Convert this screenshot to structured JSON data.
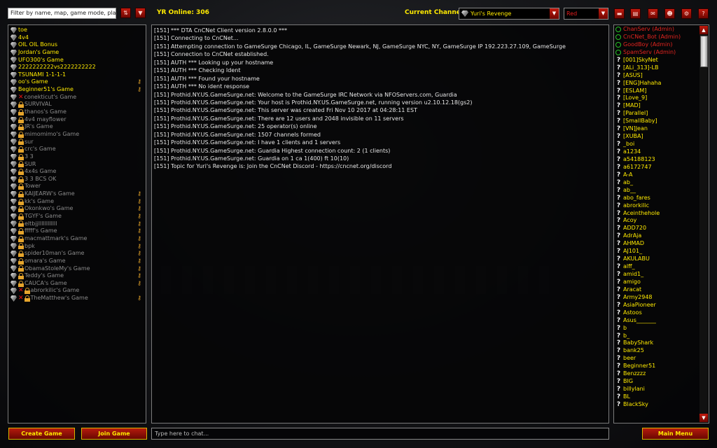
{
  "header": {
    "search_placeholder": "Filter by name, map, game mode, player...",
    "yr_online": "YR Online: 306",
    "current_channel_label": "Current Channel:",
    "channel": "Yuri's Revenge",
    "color": "Red"
  },
  "games": [
    {
      "name": "toe",
      "open": true,
      "locked": false,
      "x": false,
      "key": false
    },
    {
      "name": "4v4",
      "open": true,
      "locked": false,
      "x": false,
      "key": false
    },
    {
      "name": "OIL OIL Bonus",
      "open": true,
      "locked": false,
      "x": false,
      "key": false
    },
    {
      "name": "Jordan's Game",
      "open": true,
      "locked": false,
      "x": false,
      "key": false
    },
    {
      "name": "UFO300's Game",
      "open": true,
      "locked": false,
      "x": false,
      "key": false
    },
    {
      "name": "2222222222vs2222222222",
      "open": true,
      "locked": false,
      "x": false,
      "key": false
    },
    {
      "name": "TSUNAMI 1-1-1-1",
      "open": true,
      "locked": false,
      "x": false,
      "key": false
    },
    {
      "name": "oo's Game",
      "open": true,
      "locked": false,
      "x": false,
      "key": true
    },
    {
      "name": "Beginner51's Game",
      "open": true,
      "locked": false,
      "x": false,
      "key": true
    },
    {
      "name": "conekticut's Game",
      "open": false,
      "locked": false,
      "x": true,
      "key": false
    },
    {
      "name": "SURVIVAL",
      "open": false,
      "locked": true,
      "x": false,
      "key": false
    },
    {
      "name": "thanos's Game",
      "open": false,
      "locked": true,
      "x": false,
      "key": false
    },
    {
      "name": "4v4 mayflower",
      "open": false,
      "locked": true,
      "x": false,
      "key": false
    },
    {
      "name": "JR's Game",
      "open": false,
      "locked": true,
      "x": false,
      "key": false
    },
    {
      "name": "mimomimo's Game",
      "open": false,
      "locked": true,
      "x": false,
      "key": false
    },
    {
      "name": "sur",
      "open": false,
      "locked": true,
      "x": false,
      "key": false
    },
    {
      "name": "crc's Game",
      "open": false,
      "locked": true,
      "x": false,
      "key": false
    },
    {
      "name": "3 3",
      "open": false,
      "locked": true,
      "x": false,
      "key": false
    },
    {
      "name": "SUR",
      "open": false,
      "locked": true,
      "x": false,
      "key": false
    },
    {
      "name": "4x4s Game",
      "open": false,
      "locked": true,
      "x": false,
      "key": false
    },
    {
      "name": "3 3 BCS OK",
      "open": false,
      "locked": true,
      "x": false,
      "key": false
    },
    {
      "name": "Tower",
      "open": false,
      "locked": true,
      "x": false,
      "key": false
    },
    {
      "name": "KAIJEARW's Game",
      "open": false,
      "locked": true,
      "x": false,
      "key": true
    },
    {
      "name": "kk's Game",
      "open": false,
      "locked": true,
      "x": false,
      "key": true
    },
    {
      "name": "Okonkwo's Game",
      "open": false,
      "locked": true,
      "x": false,
      "key": true
    },
    {
      "name": "TGYF's Game",
      "open": false,
      "locked": true,
      "x": false,
      "key": true
    },
    {
      "name": "eltbjjllllllllllll",
      "open": false,
      "locked": true,
      "x": false,
      "key": true
    },
    {
      "name": "fffff's Game",
      "open": false,
      "locked": true,
      "x": false,
      "key": true
    },
    {
      "name": "macmattmark's Game",
      "open": false,
      "locked": true,
      "x": false,
      "key": true
    },
    {
      "name": "bpk",
      "open": false,
      "locked": true,
      "x": false,
      "key": true
    },
    {
      "name": "spider10man's Game",
      "open": false,
      "locked": true,
      "x": false,
      "key": true
    },
    {
      "name": "omara's Game",
      "open": false,
      "locked": true,
      "x": false,
      "key": true
    },
    {
      "name": "ObamaStoleMy's Game",
      "open": false,
      "locked": true,
      "x": false,
      "key": true
    },
    {
      "name": "Teddy's Game",
      "open": false,
      "locked": true,
      "x": false,
      "key": true
    },
    {
      "name": "CAUCA's Game",
      "open": false,
      "locked": true,
      "x": false,
      "key": true
    },
    {
      "name": "abrorkilic's Game",
      "open": false,
      "locked": true,
      "x": true,
      "key": false
    },
    {
      "name": "TheMatthew's Game",
      "open": false,
      "locked": true,
      "x": true,
      "key": true
    }
  ],
  "chat_lines": [
    "[151] *** DTA CnCNet Client version 2.8.0.0 ***",
    "[151] Connecting to CnCNet...",
    "[151] Attempting connection to GameSurge Chicago, IL, GameSurge Newark, NJ, GameSurge NYC, NY, GameSurge IP 192.223.27.109, GameSurge",
    "[151] Connection to CnCNet established.",
    "[151] AUTH *** Looking up your hostname",
    "[151] AUTH *** Checking Ident",
    "[151] AUTH *** Found your hostname",
    "[151] AUTH *** No ident response",
    "[151] Prothid.NY.US.GameSurge.net: Welcome to the GameSurge IRC Network via NFOServers.com, Guardia",
    "[151] Prothid.NY.US.GameSurge.net: Your host is Prothid.NY.US.GameSurge.net, running version u2.10.12.18(gs2)",
    "[151] Prothid.NY.US.GameSurge.net: This server was created Fri Nov 10 2017 at 04:28:11 EST",
    "[151] Prothid.NY.US.GameSurge.net: There are 12 users and 2048 invisible on 11 servers",
    "[151] Prothid.NY.US.GameSurge.net: 25 operator(s) online",
    "[151] Prothid.NY.US.GameSurge.net: 1507 channels formed",
    "[151] Prothid.NY.US.GameSurge.net: I have 1 clients and 1 servers",
    "[151] Prothid.NY.US.GameSurge.net: Guardia Highest connection count: 2 (1 clients)",
    "[151] Prothid.NY.US.GameSurge.net: Guardia on 1 ca 1(400) ft 10(10)",
    "[151] Topic for Yuri's Revenge is: Join the CnCNet Discord - https://cncnet.org/discord"
  ],
  "users": [
    {
      "name": "ChanServ (Admin)",
      "admin": true
    },
    {
      "name": "CnCNet_Bot (Admin)",
      "admin": true
    },
    {
      "name": "GoodBoy (Admin)",
      "admin": true
    },
    {
      "name": "SpamServ (Admin)",
      "admin": true
    },
    {
      "name": "[001]SkyNet",
      "admin": false
    },
    {
      "name": "[ALi_313]-LB",
      "admin": false
    },
    {
      "name": "[ASUS]",
      "admin": false
    },
    {
      "name": "[ENG]Hahaha",
      "admin": false
    },
    {
      "name": "[ESLAM]",
      "admin": false
    },
    {
      "name": "[Love_9]",
      "admin": false
    },
    {
      "name": "[MAD]",
      "admin": false
    },
    {
      "name": "[Parallel]",
      "admin": false
    },
    {
      "name": "[SmallBaby]",
      "admin": false
    },
    {
      "name": "[VN]Jean",
      "admin": false
    },
    {
      "name": "[XUBA]",
      "admin": false
    },
    {
      "name": "_boi",
      "admin": false
    },
    {
      "name": "a1234",
      "admin": false
    },
    {
      "name": "a54188123",
      "admin": false
    },
    {
      "name": "a6172747",
      "admin": false
    },
    {
      "name": "A-A",
      "admin": false
    },
    {
      "name": "ab_",
      "admin": false
    },
    {
      "name": "ab__",
      "admin": false
    },
    {
      "name": "abo_fares",
      "admin": false
    },
    {
      "name": "abrorkilic",
      "admin": false
    },
    {
      "name": "Aceinthehole",
      "admin": false
    },
    {
      "name": "Acoy",
      "admin": false
    },
    {
      "name": "ADD720",
      "admin": false
    },
    {
      "name": "AdrAja",
      "admin": false
    },
    {
      "name": "AHMAD",
      "admin": false
    },
    {
      "name": "AJ101_",
      "admin": false
    },
    {
      "name": "AKULABU",
      "admin": false
    },
    {
      "name": "alff_",
      "admin": false
    },
    {
      "name": "amid1_",
      "admin": false
    },
    {
      "name": "amigo",
      "admin": false
    },
    {
      "name": "Aracat",
      "admin": false
    },
    {
      "name": "Army2948",
      "admin": false
    },
    {
      "name": "AsiaPioneer",
      "admin": false
    },
    {
      "name": "Astoos",
      "admin": false
    },
    {
      "name": "Asus_______",
      "admin": false
    },
    {
      "name": "b",
      "admin": false
    },
    {
      "name": "b_",
      "admin": false
    },
    {
      "name": "BabyShark",
      "admin": false
    },
    {
      "name": "bank25",
      "admin": false
    },
    {
      "name": "beer",
      "admin": false
    },
    {
      "name": "Beginner51",
      "admin": false
    },
    {
      "name": "Benzzzz",
      "admin": false
    },
    {
      "name": "BIG",
      "admin": false
    },
    {
      "name": "billylani",
      "admin": false
    },
    {
      "name": "BL",
      "admin": false
    },
    {
      "name": "BlackSky",
      "admin": false
    }
  ],
  "footer": {
    "create_game": "Create Game",
    "join_game": "Join Game",
    "chat_placeholder": "Type here to chat...",
    "main_menu": "Main Menu"
  },
  "colors": {
    "accent_yellow": "#ffea00",
    "admin_red": "#e3241f",
    "button_red": "#b51a0c"
  }
}
